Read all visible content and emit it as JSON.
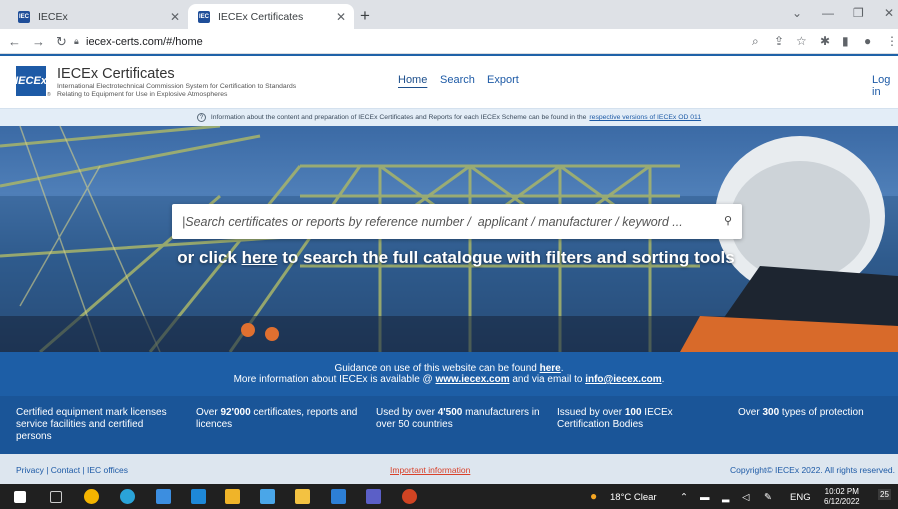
{
  "browser": {
    "tabs": [
      {
        "title": "IECEx",
        "favicon": "IECEx"
      },
      {
        "title": "IECEx Certificates",
        "favicon": "IECEx"
      }
    ],
    "new_tab": "+",
    "url": "iecex-certs.com/#/home"
  },
  "header": {
    "logo_text": "IECEx",
    "title": "IECEx Certificates",
    "subtitle": "International Electrotechnical Commission System for Certification to Standards Relating to Equipment for Use in Explosive Atmospheres",
    "nav": {
      "home": "Home",
      "search": "Search",
      "export": "Export"
    },
    "login": "Log in"
  },
  "info": {
    "text": "Information about the content and preparation of IECEx Certificates and Reports for each IECEx Scheme can be found in the",
    "link": "respective versions of IECEx OD 011"
  },
  "hero": {
    "search_placeholder": "|Search certificates or reports by reference number /  applicant / manufacturer / keyword ...",
    "catalogue_prefix": "or click",
    "catalogue_link": "here",
    "catalogue_suffix": "to search the full catalogue with filters and sorting tools"
  },
  "guidance": {
    "line1_text": "Guidance on use of this website can be found",
    "line1_link": "here",
    "line1_end": ".",
    "line2_text": "More information about IECEx is available @",
    "line2_link1": "www.iecex.com",
    "line2_mid": "and via email to",
    "line2_link2": "info@iecex.com",
    "line2_end": "."
  },
  "stats": [
    {
      "pre": "Certified equipment mark licenses service facilities and certified persons",
      "bold": "",
      "post": ""
    },
    {
      "pre": "Over",
      "bold": "92'000",
      "post": "certificates, reports and licences"
    },
    {
      "pre": "Used by over",
      "bold": "4'500",
      "post": "manufacturers in over 50 countries"
    },
    {
      "pre": "Issued by over",
      "bold": "100",
      "post": "IECEx Certification Bodies"
    },
    {
      "pre": "Over",
      "bold": "300",
      "post": "types of protection"
    }
  ],
  "footer": {
    "left": "Privacy | Contact | IEC offices",
    "center": "Important information",
    "right": "Copyright© IECEx 2022. All rights reserved."
  },
  "taskbar": {
    "weather": "18°C  Clear",
    "lang": "ENG",
    "time": "10:02 PM",
    "date": "6/12/2022",
    "notif": "25"
  },
  "colors": {
    "brand_blue": "#1d5aa6",
    "stats_bg": "#1a5598",
    "footer_bg": "#dde6ef",
    "important_red": "#d9412a"
  }
}
